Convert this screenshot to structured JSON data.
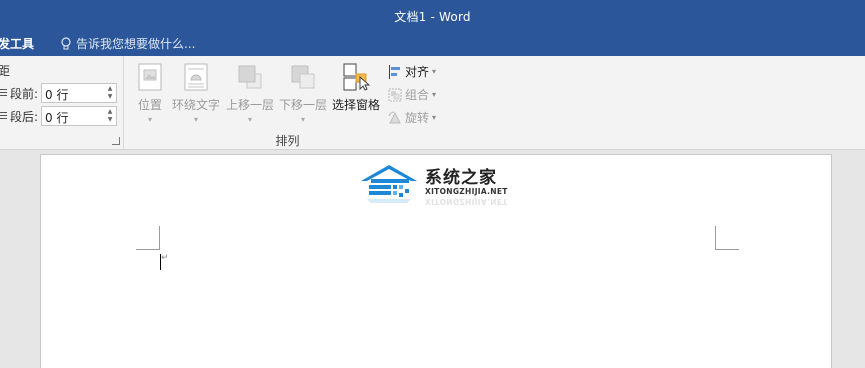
{
  "window": {
    "title": "文档1 - Word"
  },
  "tabs": {
    "partial_tab": "发工具",
    "tell_me": "告诉我您想要做什么..."
  },
  "paragraph": {
    "spacing_label": "距",
    "before_label": "段前:",
    "before_value": "0 行",
    "after_label": "段后:",
    "after_value": "0 行"
  },
  "arrange": {
    "group_label": "排列",
    "buttons": [
      {
        "label": "位置",
        "state": "disabled"
      },
      {
        "label": "环绕文字",
        "state": "disabled"
      },
      {
        "label": "上移一层",
        "state": "disabled"
      },
      {
        "label": "下移一层",
        "state": "disabled"
      },
      {
        "label": "选择窗格",
        "state": "enabled"
      }
    ],
    "small_buttons": [
      {
        "label": "对齐",
        "state": "enabled"
      },
      {
        "label": "组合",
        "state": "disabled"
      },
      {
        "label": "旋转",
        "state": "disabled"
      }
    ]
  },
  "watermark": {
    "brand_cn": "系统之家",
    "brand_en": "XITONGZHIJIA.NET"
  },
  "colors": {
    "title_bar": "#2b579a",
    "ribbon": "#f3f3f3",
    "canvas": "#e6e6e6",
    "logo_blue": "#1e88d8"
  }
}
